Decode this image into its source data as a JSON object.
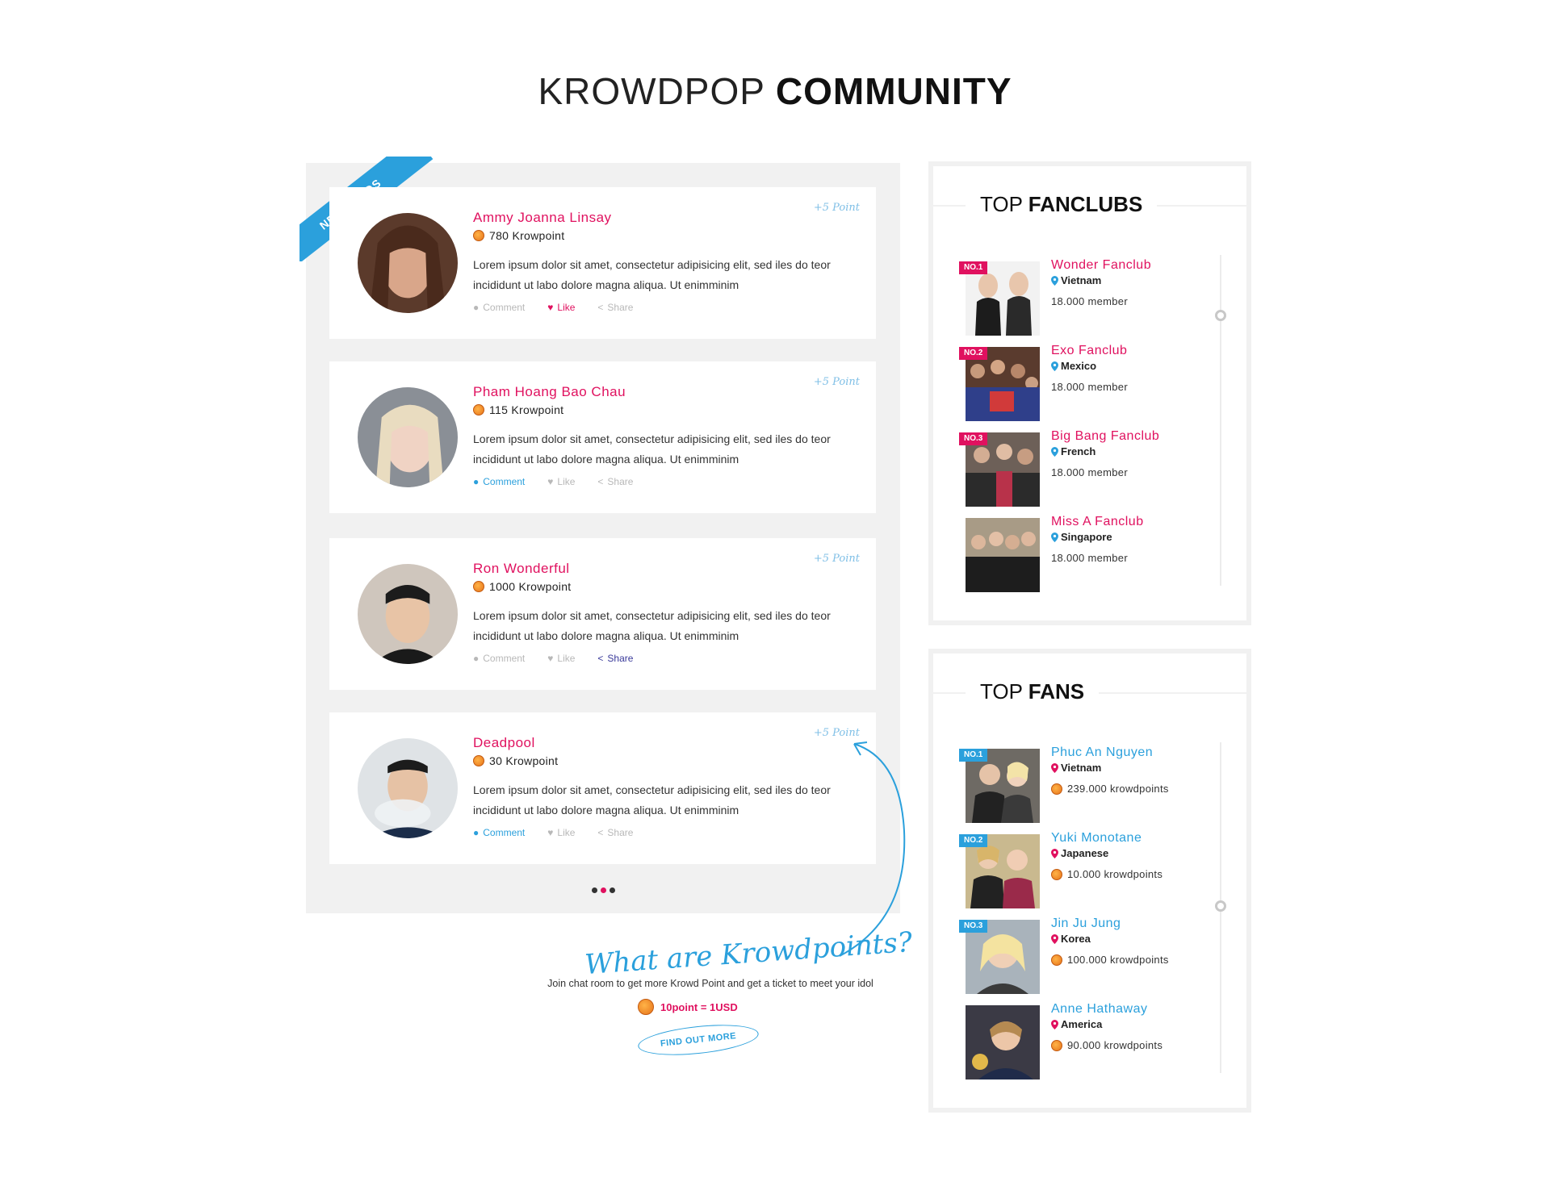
{
  "header": {
    "title_light": "KROWDPOP",
    "title_bold": "COMMUNITY"
  },
  "feed": {
    "ribbon": "NEW FEEDS",
    "posts": [
      {
        "name": "Ammy Joanna Linsay",
        "points": "780 Krowpoint",
        "text": "Lorem ipsum dolor sit amet, consectetur adipisicing elit, sed iles do teor incididunt ut labo dolore magna aliqua. Ut enimminim",
        "bonus": "+5 Point",
        "comment": "Comment",
        "like": "Like",
        "share": "Share",
        "active": "like"
      },
      {
        "name": "Pham Hoang Bao Chau",
        "points": "115 Krowpoint",
        "text": "Lorem ipsum dolor sit amet, consectetur adipisicing elit, sed iles do teor incididunt ut labo dolore magna aliqua. Ut enimminim",
        "bonus": "+5 Point",
        "comment": "Comment",
        "like": "Like",
        "share": "Share",
        "active": "comment"
      },
      {
        "name": "Ron Wonderful",
        "points": "1000 Krowpoint",
        "text": "Lorem ipsum dolor sit amet, consectetur adipisicing elit, sed iles do teor incididunt ut labo dolore magna aliqua. Ut enimminim",
        "bonus": "+5 Point",
        "comment": "Comment",
        "like": "Like",
        "share": "Share",
        "active": "share"
      },
      {
        "name": "Deadpool",
        "points": "30 Krowpoint",
        "text": "Lorem ipsum dolor sit amet, consectetur adipisicing elit, sed iles do teor incididunt ut labo dolore magna aliqua. Ut enimminim",
        "bonus": "+5 Point",
        "comment": "Comment",
        "like": "Like",
        "share": "Share",
        "active": "comment"
      }
    ]
  },
  "promo": {
    "title": "What are Krowdpoints?",
    "subtitle": "Join chat room to get more Krowd Point and get a ticket to meet your idol",
    "rate": "10point = 1USD",
    "button": "FIND OUT MORE"
  },
  "top_fanclubs": {
    "title_light": "TOP",
    "title_bold": "FANCLUBS",
    "items": [
      {
        "badge": "NO.1",
        "name": "Wonder Fanclub",
        "location": "Vietnam",
        "meta": "18.000 member"
      },
      {
        "badge": "NO.2",
        "name": "Exo Fanclub",
        "location": "Mexico",
        "meta": "18.000 member"
      },
      {
        "badge": "NO.3",
        "name": "Big Bang Fanclub",
        "location": "French",
        "meta": "18.000 member"
      },
      {
        "badge": "",
        "name": "Miss A Fanclub",
        "location": "Singapore",
        "meta": "18.000 member"
      }
    ]
  },
  "top_fans": {
    "title_light": "TOP",
    "title_bold": "FANS",
    "items": [
      {
        "badge": "NO.1",
        "name": "Phuc An Nguyen",
        "location": "Vietnam",
        "meta": "239.000 krowdpoints"
      },
      {
        "badge": "NO.2",
        "name": "Yuki Monotane",
        "location": "Japanese",
        "meta": "10.000 krowdpoints"
      },
      {
        "badge": "NO.3",
        "name": "Jin Ju Jung",
        "location": "Korea",
        "meta": "100.000 krowdpoints"
      },
      {
        "badge": "",
        "name": "Anne Hathaway",
        "location": "America",
        "meta": "90.000 krowdpoints"
      }
    ]
  },
  "colors": {
    "pink": "#e0115f",
    "blue": "#2ba0dc",
    "panel": "#f1f1f1"
  }
}
